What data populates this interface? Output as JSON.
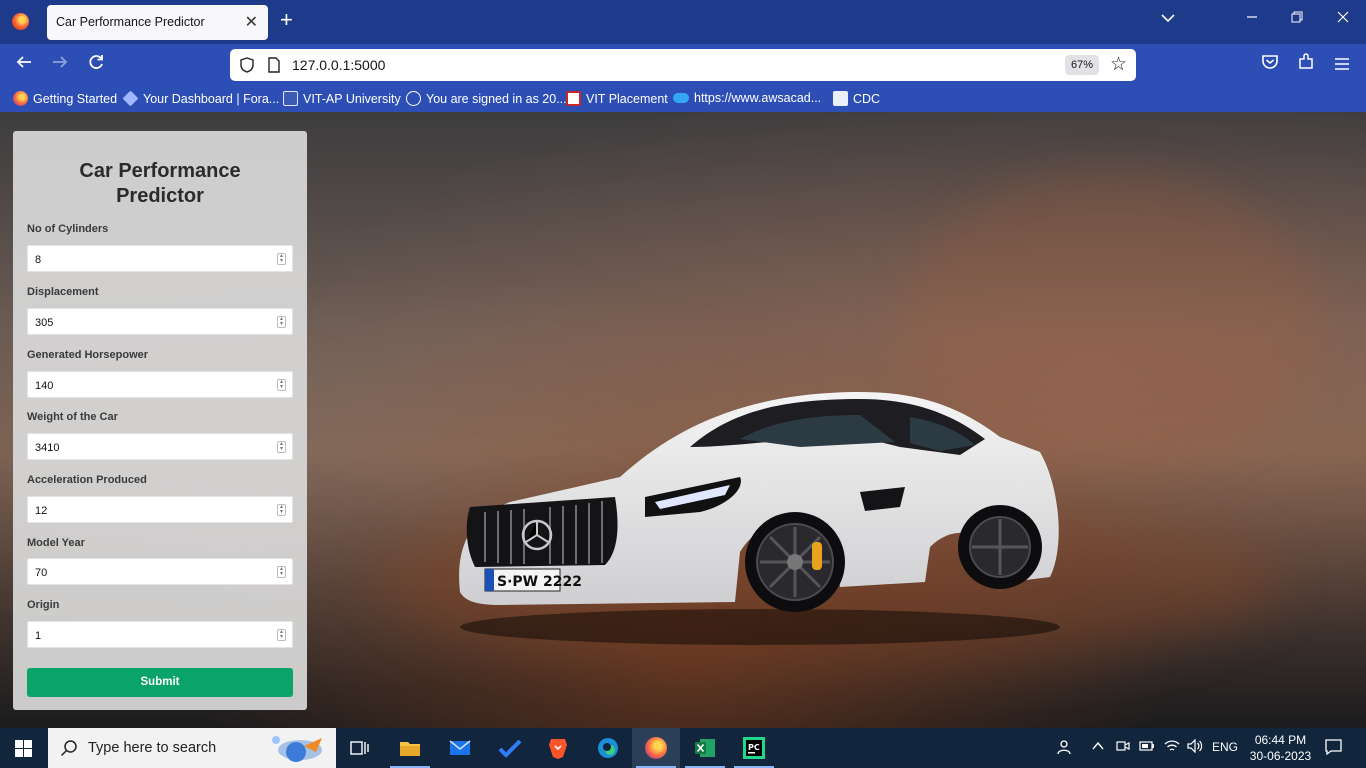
{
  "browser": {
    "tab_title": "Car Performance Predictor",
    "url": "127.0.0.1:5000",
    "zoom": "67%"
  },
  "bookmarks": [
    {
      "label": "Getting Started",
      "icon": "firefox-icon"
    },
    {
      "label": "Your Dashboard | Fora...",
      "icon": "diamond-icon"
    },
    {
      "label": "VIT-AP University",
      "icon": "university-icon"
    },
    {
      "label": "You are signed in as 20...",
      "icon": "globe-icon"
    },
    {
      "label": "VIT Placement",
      "icon": "placement-icon"
    },
    {
      "label": "https://www.awsacad...",
      "icon": "cloud-icon"
    },
    {
      "label": "CDC",
      "icon": "cdc-icon"
    }
  ],
  "form": {
    "title": "Car Performance Predictor",
    "fields": [
      {
        "label": "No of Cylinders",
        "value": "8"
      },
      {
        "label": "Displacement",
        "value": "305"
      },
      {
        "label": "Generated Horsepower",
        "value": "140"
      },
      {
        "label": "Weight of the Car",
        "value": "3410"
      },
      {
        "label": "Acceleration Produced",
        "value": "12"
      },
      {
        "label": "Model Year",
        "value": "70"
      },
      {
        "label": "Origin",
        "value": "1"
      }
    ],
    "submit_label": "Submit"
  },
  "background": {
    "license_plate": "S·PW 2222"
  },
  "taskbar": {
    "search_placeholder": "Type here to search",
    "language": "ENG",
    "time": "06:44 PM",
    "date": "30-06-2023"
  },
  "colors": {
    "tab_strip": "#1e3a8a",
    "toolbar": "#2d4fb5",
    "submit": "#0aa36a",
    "taskbar": "#11253d"
  }
}
